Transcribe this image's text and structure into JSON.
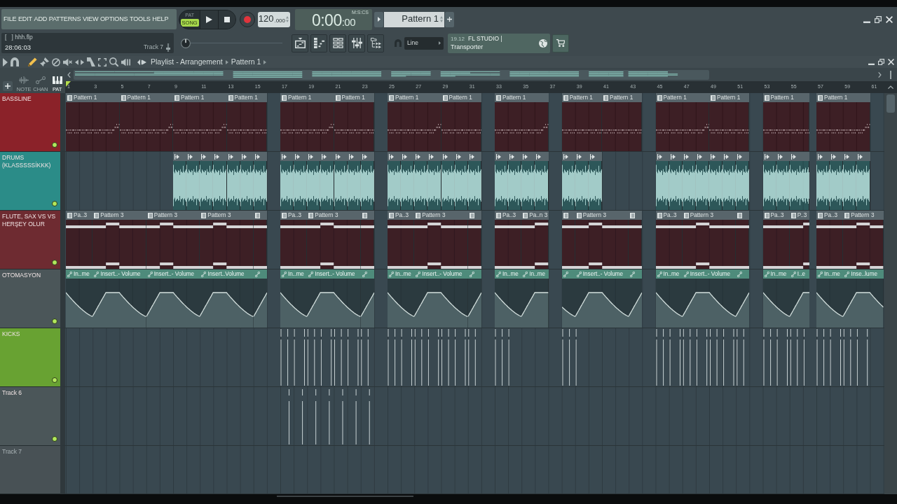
{
  "menu": [
    "FILE",
    "EDIT",
    "ADD",
    "PATTERNS",
    "VIEW",
    "OPTIONS",
    "TOOLS",
    "HELP"
  ],
  "transport": {
    "modes": [
      {
        "label": "PAT",
        "selected": false
      },
      {
        "label": "SONG",
        "selected": true
      }
    ],
    "tempo": "120",
    "tempo_decimals": ".000"
  },
  "time": {
    "main": "0:00",
    "small": ":00",
    "unit": "M:S:CS"
  },
  "pattern_selector": {
    "value": "Pattern 1"
  },
  "project": {
    "file": "[   ] hhh.flp",
    "duration": "28:06:03",
    "hint": "Track 7"
  },
  "master_slider": {
    "level": 0.02
  },
  "snap": {
    "value": "Line"
  },
  "hint_panel": {
    "version": "19.12",
    "title": "FL STUDIO |",
    "text": "Transporter"
  },
  "playlist": {
    "title": "Playlist - Arrangement",
    "pattern": "Pattern 1",
    "tools": [
      {
        "kind": "options",
        "selected": false
      },
      {
        "kind": "snap",
        "selected": false
      },
      {
        "kind": "draw",
        "selected": true
      },
      {
        "kind": "paint",
        "selected": false
      },
      {
        "kind": "delete",
        "selected": false
      },
      {
        "kind": "mute",
        "selected": false
      },
      {
        "kind": "slip",
        "selected": false
      },
      {
        "kind": "slice",
        "selected": false
      },
      {
        "kind": "select",
        "selected": false
      },
      {
        "kind": "zoom",
        "selected": false
      },
      {
        "kind": "playback",
        "selected": false
      }
    ],
    "filters": [
      {
        "label": "NOTE",
        "selected": false
      },
      {
        "label": "CHAN",
        "selected": false
      },
      {
        "label": "PAT",
        "selected": true
      }
    ]
  },
  "ruler": [
    "1",
    "3",
    "5",
    "7",
    "9",
    "11",
    "13",
    "15",
    "17",
    "19",
    "21",
    "23",
    "25",
    "27",
    "29",
    "31",
    "33",
    "35",
    "37",
    "39",
    "41",
    "43",
    "45",
    "47",
    "49",
    "51",
    "53",
    "55",
    "57",
    "59",
    "61"
  ],
  "tracks": [
    {
      "name": "BASSLINE",
      "color": "#8b2229",
      "active": true,
      "kind": "staccato",
      "clips": [
        "Pattern 1",
        "Pattern 1",
        "Pattern 1",
        "Pattern 1",
        "Pattern 1",
        "Pattern 1",
        "Pattern 1",
        "Pattern 1",
        "Pattern 1",
        "Pattern 1",
        "Pattern 1",
        "Pattern 1",
        "Pattern 1",
        "Pattern 1",
        "Pattern 1"
      ]
    },
    {
      "name": "DRUMS (KLASSSSSİKKK)",
      "color": "#2b8c88",
      "active": true,
      "kind": "audio"
    },
    {
      "name": "FLUTE, SAX VS VS HERŞEY OLUR",
      "color": "#6e2b31",
      "active": true,
      "kind": "legato",
      "clips": [
        "Pa..3",
        "Pattern 3",
        "Pattern 3",
        "Pattern 3",
        "Pa..3",
        "Pattern 3",
        "Pa..3",
        "Pattern 3",
        "Pa..3",
        "Pa..n 3",
        "Pattern 3",
        "Pa..3",
        "Pattern 3",
        "Pa..3",
        "P..3",
        "Pa..3",
        "Pattern 3"
      ]
    },
    {
      "name": "OTOMASYON",
      "color": "#4b5659",
      "active": true,
      "kind": "automation",
      "clips": [
        "In..me",
        "Insert..- Volume",
        "Insert..- Volume",
        "Insert..Volume",
        "In..me",
        "Insert..- Volume",
        "In..me",
        "Insert..- Volume",
        "In..me",
        "In..me",
        "Insert..- Volume",
        "In..me",
        "Insert..- Volume",
        "In..me",
        "I..e",
        "In..me",
        "Inse..lume"
      ]
    },
    {
      "name": "KICKS",
      "color": "#68a232",
      "active": true,
      "kind": "beats"
    },
    {
      "name": "Track 6",
      "color": "#4b5659",
      "active": true,
      "kind": "pulses"
    },
    {
      "name": "Track 7",
      "color": "#485155",
      "active": false
    }
  ]
}
